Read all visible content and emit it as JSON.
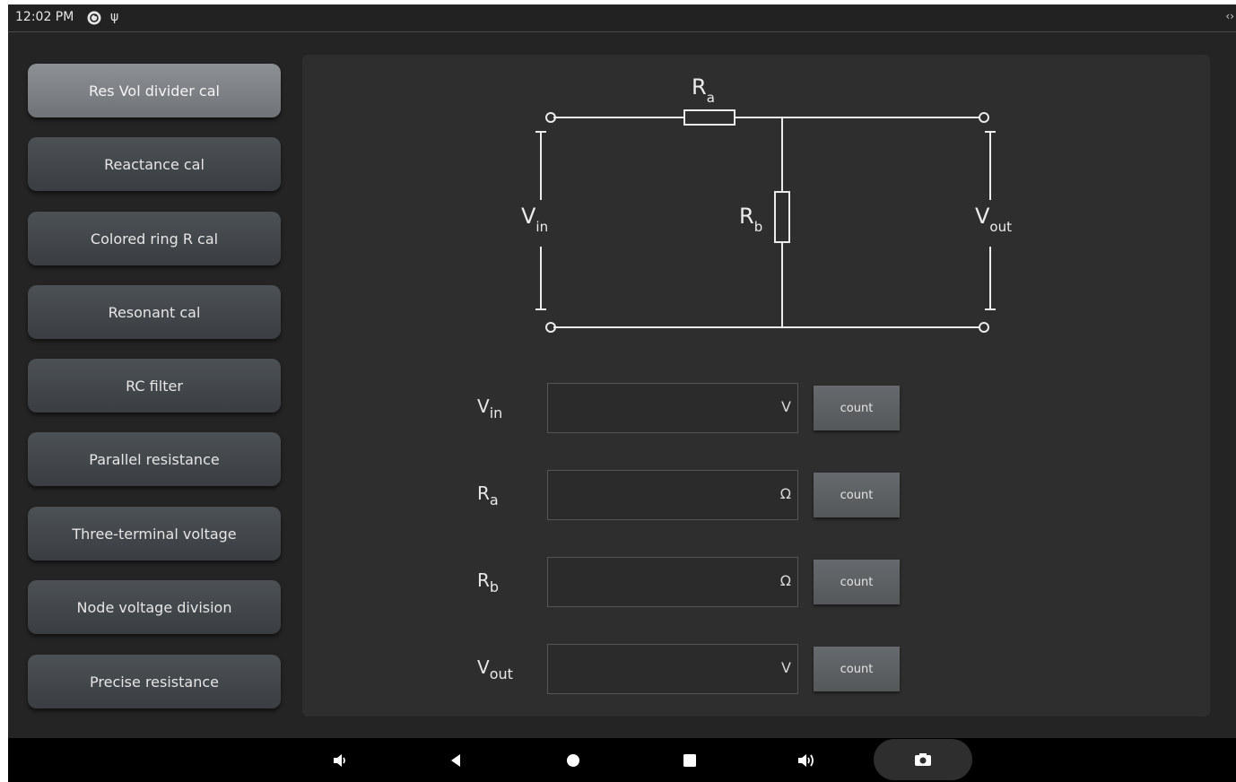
{
  "status_bar": {
    "time": "12:02 PM",
    "right_icon": "‹›"
  },
  "sidebar": {
    "items": [
      {
        "label": "Res Vol divider cal",
        "active": true
      },
      {
        "label": "Reactance cal",
        "active": false
      },
      {
        "label": "Colored ring R cal",
        "active": false
      },
      {
        "label": "Resonant cal",
        "active": false
      },
      {
        "label": "RC filter",
        "active": false
      },
      {
        "label": "Parallel resistance",
        "active": false
      },
      {
        "label": "Three-terminal voltage",
        "active": false
      },
      {
        "label": "Node voltage division",
        "active": false
      },
      {
        "label": "Precise resistance",
        "active": false
      }
    ]
  },
  "circuit": {
    "ra": {
      "main": "R",
      "sub": "a"
    },
    "rb": {
      "main": "R",
      "sub": "b"
    },
    "vin": {
      "main": "V",
      "sub": "in"
    },
    "vout": {
      "main": "V",
      "sub": "out"
    }
  },
  "fields": [
    {
      "label_main": "V",
      "label_sub": "in",
      "value": "",
      "unit": "V",
      "button": "count"
    },
    {
      "label_main": "R",
      "label_sub": "a",
      "value": "",
      "unit": "Ω",
      "button": "count"
    },
    {
      "label_main": "R",
      "label_sub": "b",
      "value": "",
      "unit": "Ω",
      "button": "count"
    },
    {
      "label_main": "V",
      "label_sub": "out",
      "value": "",
      "unit": "V",
      "button": "count"
    }
  ],
  "nav_bar": {
    "icons": [
      "volume-down-icon",
      "back-icon",
      "home-icon",
      "recents-icon",
      "volume-up-icon",
      "screenshot-icon"
    ]
  },
  "colors": {
    "background": "#242424",
    "panel": "#2e2e2e",
    "active_button": "#8d9195",
    "button": "#44484c",
    "wire": "#ececec"
  }
}
